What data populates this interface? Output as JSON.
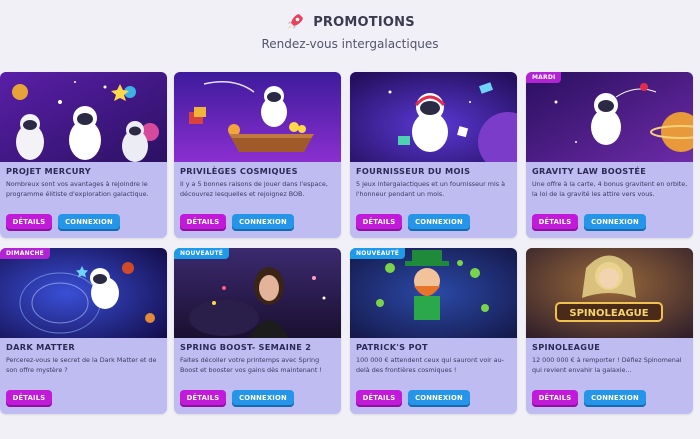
{
  "header": {
    "title": "PROMOTIONS",
    "subtitle": "Rendez-vous intergalactiques",
    "icon": "rocket-icon"
  },
  "buttons": {
    "details_label": "DÉTAILS",
    "connexion_label": "CONNEXION"
  },
  "colors": {
    "card_background": "#bfbcf2",
    "details_button": "#c21ad9",
    "connexion_button": "#2595e8",
    "badge_purple": "#b223d4",
    "badge_blue": "#1f9ae6"
  },
  "cards": [
    {
      "title": "PROJET MERCURY",
      "description": "Nombreux sont vos avantages à rejoindre le programme élitiste d'exploration galactique.",
      "badge": "",
      "show_connexion": true
    },
    {
      "title": "PRIVILÈGES COSMIQUES",
      "description": "Il y a 5 bonnes raisons de jouer dans l'espace, découvrez lesquelles et rejoignez BOB.",
      "badge": "",
      "show_connexion": true
    },
    {
      "title": "FOURNISSEUR DU MOIS",
      "description": "5 jeux intergalactiques et un fournisseur mis à l'honneur pendant un mois.",
      "badge": "",
      "show_connexion": true
    },
    {
      "title": "GRAVITY LAW BOOSTÉE",
      "description": "Une offre à la carte, 4 bonus gravitent en orbite, la loi de la gravité les attire vers vous.",
      "badge": "MARDI",
      "show_connexion": true
    },
    {
      "title": "DARK MATTER",
      "description": "Percerez-vous le secret de la Dark Matter et de son offre mystère ?",
      "badge": "DIMANCHE",
      "show_connexion": false
    },
    {
      "title": "SPRING BOOST- SEMAINE 2",
      "description": "Faites décoller votre printemps avec Spring Boost et booster vos gains dès maintenant !",
      "badge": "NOUVEAUTÉ",
      "show_connexion": true
    },
    {
      "title": "PATRICK'S POT",
      "description": "100 000 € attendent ceux qui sauront voir au-delà des frontières cosmiques !",
      "badge": "NOUVEAUTÉ",
      "show_connexion": true
    },
    {
      "title": "SPINOLEAGUE",
      "description": "12 000 000 € à remporter ! Défiez Spinomenal qui revient envahir la galaxie...",
      "badge": "",
      "show_connexion": true,
      "logo_text": "SPINOLEAGUE"
    }
  ]
}
